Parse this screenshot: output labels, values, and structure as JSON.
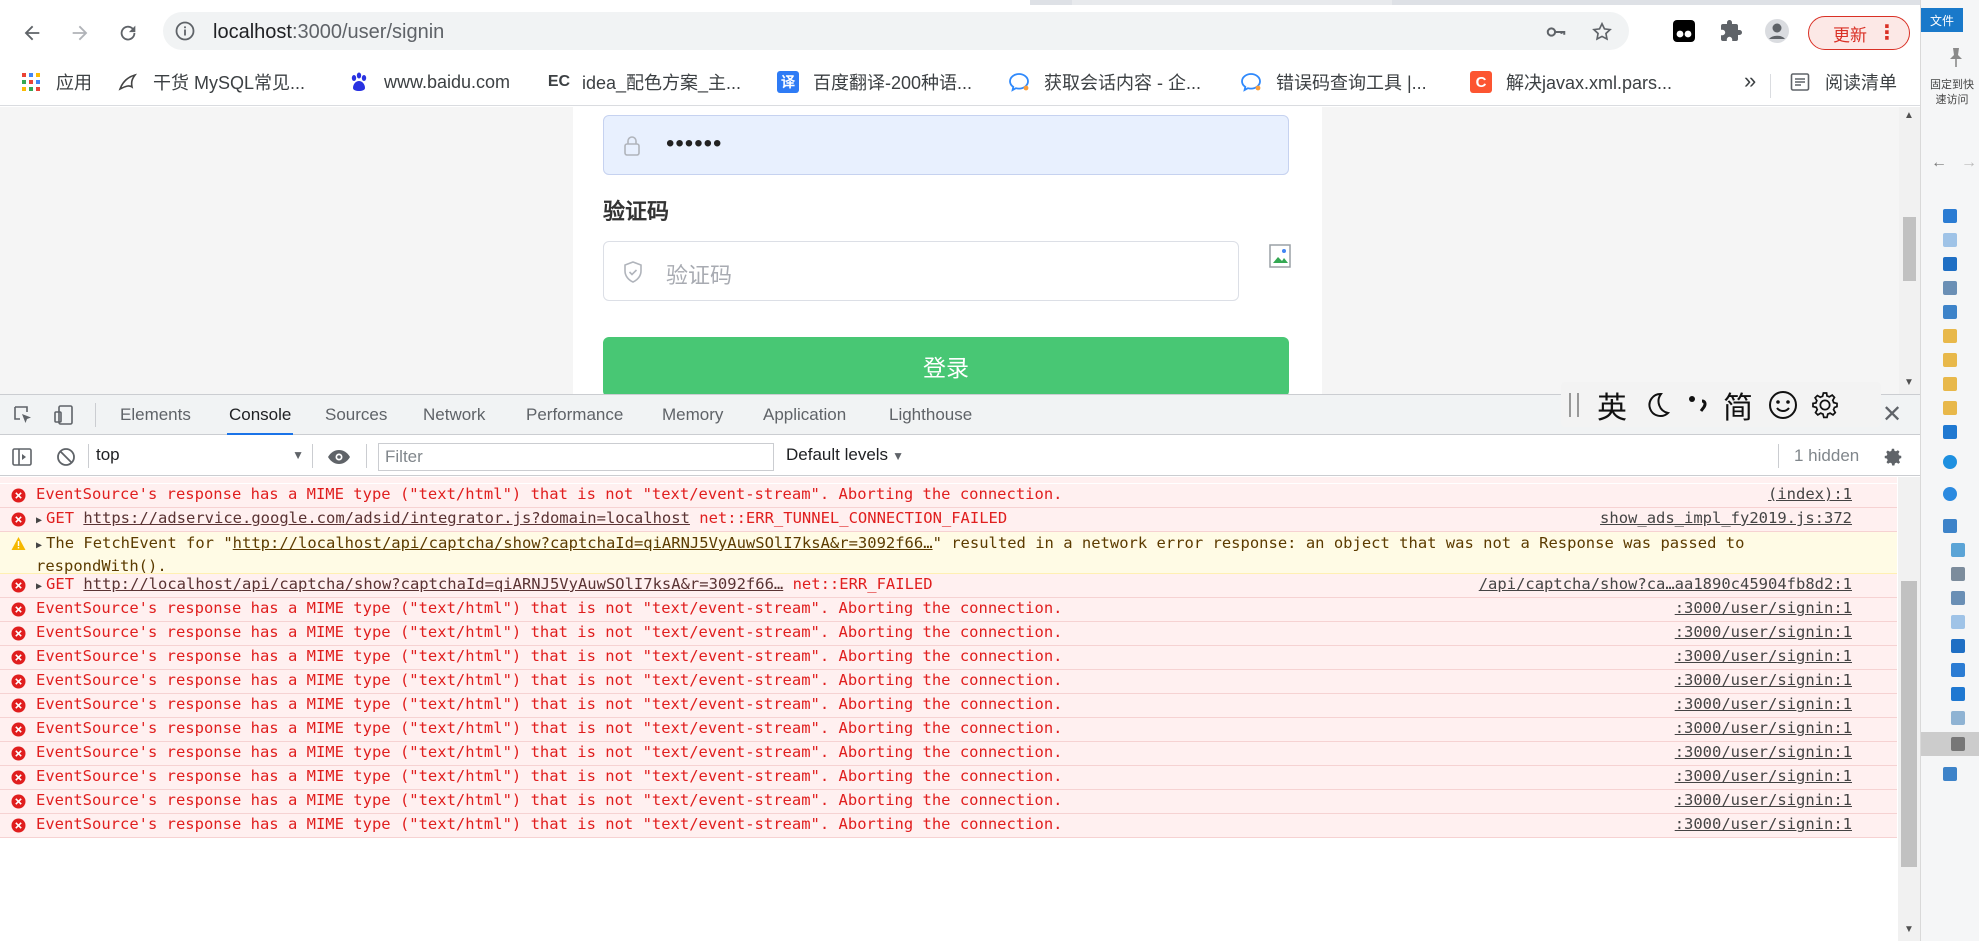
{
  "browser": {
    "url_host": "localhost",
    "url_path": ":3000/user/signin",
    "update_label": "更新",
    "bookmarks": [
      {
        "label": "应用",
        "icon": "apps-grid-icon"
      },
      {
        "label": "干货 MySQL常见...",
        "icon": "mysql-dolphin-icon"
      },
      {
        "label": "www.baidu.com",
        "icon": "baidu-paw-icon"
      },
      {
        "label": "idea_配色方案_主...",
        "icon": "ec-logo-icon",
        "badge": "EC"
      },
      {
        "label": "百度翻译-200种语...",
        "icon": "translate-icon",
        "badge": "译"
      },
      {
        "label": "获取会话内容 - 企...",
        "icon": "wecom-icon"
      },
      {
        "label": "错误码查询工具 |...",
        "icon": "wecom-icon"
      },
      {
        "label": "解决javax.xml.pars...",
        "icon": "csdn-c-icon",
        "badge": "C"
      }
    ],
    "bookmarks_more": "»",
    "reading_list": "阅读清单"
  },
  "page": {
    "password_value": "••••••",
    "captcha_label": "验证码",
    "captcha_placeholder": "验证码",
    "login_label": "登录"
  },
  "ime": {
    "items": [
      "英",
      "简"
    ]
  },
  "devtools": {
    "tabs": [
      "Elements",
      "Console",
      "Sources",
      "Network",
      "Performance",
      "Memory",
      "Application",
      "Lighthouse"
    ],
    "active_tab": "Console",
    "context": "top",
    "filter_placeholder": "Filter",
    "levels": "Default levels",
    "hidden": "1 hidden",
    "messages": [
      {
        "level": "error",
        "text": "EventSource's response has a MIME type (\"text/html\") that is not \"text/event-stream\". Aborting the connection.",
        "source": "(index):1"
      },
      {
        "level": "error",
        "prefix": "GET ",
        "link": "https://adservice.google.com/adsid/integrator.js?domain=localhost",
        "suffix": " net::ERR_TUNNEL_CONNECTION_FAILED",
        "source": "show_ads_impl_fy2019.js:372"
      },
      {
        "level": "warn",
        "prefix": "The FetchEvent for \"",
        "link": "http://localhost/api/captcha/show?captchaId=qiARNJ5VyAuwSOlI7ksA&r=3092f66…",
        "suffix": "\" resulted in a network error response: an object that was not a Response was passed to respondWith().",
        "source": ""
      },
      {
        "level": "error",
        "prefix": "GET ",
        "link": "http://localhost/api/captcha/show?captchaId=qiARNJ5VyAuwSOlI7ksA&r=3092f66…",
        "suffix": " net::ERR_FAILED",
        "source": "/api/captcha/show?ca…aa1890c45904fb8d2:1"
      },
      {
        "level": "error",
        "text": "EventSource's response has a MIME type (\"text/html\") that is not \"text/event-stream\". Aborting the connection.",
        "source": ":3000/user/signin:1"
      },
      {
        "level": "error",
        "text": "EventSource's response has a MIME type (\"text/html\") that is not \"text/event-stream\". Aborting the connection.",
        "source": ":3000/user/signin:1"
      },
      {
        "level": "error",
        "text": "EventSource's response has a MIME type (\"text/html\") that is not \"text/event-stream\". Aborting the connection.",
        "source": ":3000/user/signin:1"
      },
      {
        "level": "error",
        "text": "EventSource's response has a MIME type (\"text/html\") that is not \"text/event-stream\". Aborting the connection.",
        "source": ":3000/user/signin:1"
      },
      {
        "level": "error",
        "text": "EventSource's response has a MIME type (\"text/html\") that is not \"text/event-stream\". Aborting the connection.",
        "source": ":3000/user/signin:1"
      },
      {
        "level": "error",
        "text": "EventSource's response has a MIME type (\"text/html\") that is not \"text/event-stream\". Aborting the connection.",
        "source": ":3000/user/signin:1"
      },
      {
        "level": "error",
        "text": "EventSource's response has a MIME type (\"text/html\") that is not \"text/event-stream\". Aborting the connection.",
        "source": ":3000/user/signin:1"
      },
      {
        "level": "error",
        "text": "EventSource's response has a MIME type (\"text/html\") that is not \"text/event-stream\". Aborting the connection.",
        "source": ":3000/user/signin:1"
      },
      {
        "level": "error",
        "text": "EventSource's response has a MIME type (\"text/html\") that is not \"text/event-stream\". Aborting the connection.",
        "source": ":3000/user/signin:1"
      },
      {
        "level": "error",
        "text": "EventSource's response has a MIME type (\"text/html\") that is not \"text/event-stream\". Aborting the connection.",
        "source": ":3000/user/signin:1"
      }
    ]
  },
  "explorer": {
    "file_tab": "文件",
    "pin_text": "固定到快速访问"
  },
  "colors": {
    "error_bg": "#fff0f0",
    "error_text": "#e01e1e",
    "warn_bg": "#fffbe5",
    "login_green": "#48c774",
    "update_red": "#d93025",
    "devtools_accent": "#1a73e8"
  }
}
